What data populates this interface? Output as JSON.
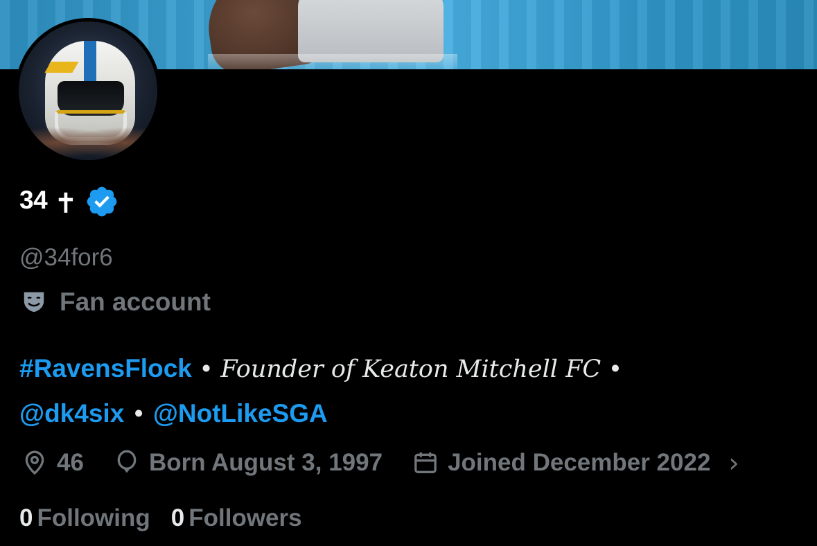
{
  "profile": {
    "display_name": "34",
    "name_emoji": "✝",
    "handle": "@34for6",
    "affiliation": "Fan account",
    "verified": true
  },
  "bio": {
    "hashtag": "#RavensFlock",
    "sep1": "•",
    "script_text": "Founder of Keaton Mitchell FC",
    "sep2": "•",
    "mention1": "@dk4six",
    "sep3": "•",
    "mention2": "@NotLikeSGA"
  },
  "meta": {
    "location": "46",
    "birthday": "Born August 3, 1997",
    "joined": "Joined December 2022",
    "expand_chevron": "›"
  },
  "stats": {
    "following_count": "0",
    "following_label": "Following",
    "followers_count": "0",
    "followers_label": "Followers"
  },
  "colors": {
    "background": "#000000",
    "accent": "#1d9bf0",
    "muted": "#71767b",
    "text": "#e7e9ea"
  },
  "icons": {
    "verified": "verified-badge-icon",
    "affiliation": "theater-mask-icon",
    "location": "location-pin-icon",
    "birthday": "balloon-icon",
    "joined": "calendar-icon"
  }
}
